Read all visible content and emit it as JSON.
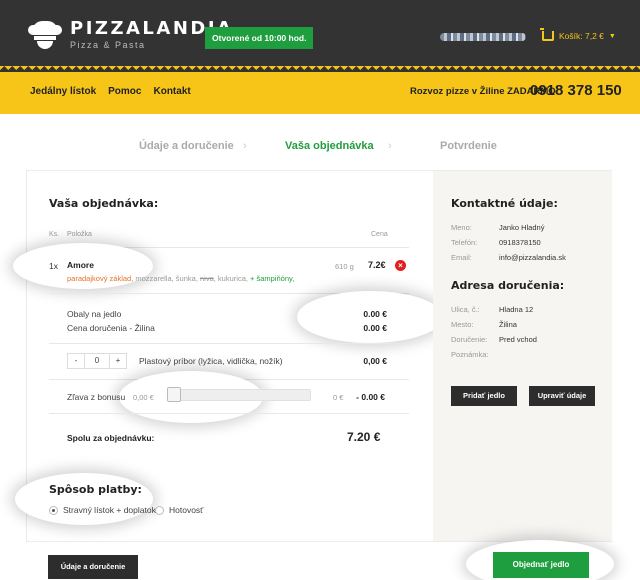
{
  "header": {
    "logo_title": "PIZZALANDIA",
    "logo_sub": "Pizza & Pasta",
    "open_badge": "Otvorené od 10:00 hod.",
    "cart_label": "Košík: 7,2 €"
  },
  "nav": {
    "items": [
      "Jedálny lístok",
      "Pomoc",
      "Kontakt"
    ],
    "delivery_free": "Rozvoz pizze v Žiline ZADARMO",
    "phone": "0918 378 150"
  },
  "steps": [
    "Údaje a doručenie",
    "Vaša objednávka",
    "Potvrdenie"
  ],
  "order": {
    "title": "Vaša objednávka:",
    "col_qty": "Ks.",
    "col_item": "Položka",
    "col_price": "Cena",
    "item": {
      "qty": "1x",
      "name": "Amore",
      "ingr_base": "paradajkový základ,",
      "ingr_mid": " mozzarella, šunka, ",
      "ingr_strike": "niva",
      "ingr_rest": ", kukurica, ",
      "ingr_add": "+ šampiňóny,",
      "weight": "610 g",
      "price": "7.2€"
    },
    "packaging_label": "Obaly na jedlo",
    "packaging_value": "0.00 €",
    "delivery_label": "Cena doručenia - Žilina",
    "delivery_value": "0.00 €",
    "cutlery_qty": "0",
    "cutlery_minus": "-",
    "cutlery_plus": "+",
    "cutlery_label": "Plastový príbor (lyžica, vidlička, nožík)",
    "cutlery_value": "0,00 €",
    "bonus_label": "Zľava z bonusu",
    "bonus_min": "0,00 €",
    "bonus_max": "0 €",
    "bonus_value": "- 0.00 €",
    "bonus_level": 0,
    "total_label": "Spolu za objednávku:",
    "total_value": "7.20 €"
  },
  "payment": {
    "title": "Spôsob platby:",
    "options": [
      "Stravný lístok + doplatok",
      "Hotovosť"
    ],
    "selected": 0
  },
  "contact": {
    "title": "Kontaktné údaje:",
    "rows": [
      {
        "k": "Meno:",
        "v": "Janko Hladný"
      },
      {
        "k": "Telefón:",
        "v": "0918378150"
      },
      {
        "k": "Email:",
        "v": "info@pizzalandia.sk"
      }
    ]
  },
  "address": {
    "title": "Adresa doručenia:",
    "rows": [
      {
        "k": "Ulica, č.:",
        "v": "Hladna 12"
      },
      {
        "k": "Mesto:",
        "v": "Žilina"
      },
      {
        "k": "Doručenie:",
        "v": "Pred vchod"
      },
      {
        "k": "Poznámka:",
        "v": ""
      }
    ]
  },
  "buttons": {
    "add_food": "Pridať jedlo",
    "edit_info": "Upraviť údaje",
    "back": "Údaje a doručenie",
    "order": "Objednať jedlo"
  },
  "colors": {
    "accent_green": "#1e9e3e",
    "brand_yellow": "#f6c518",
    "header_dark": "#333333"
  }
}
